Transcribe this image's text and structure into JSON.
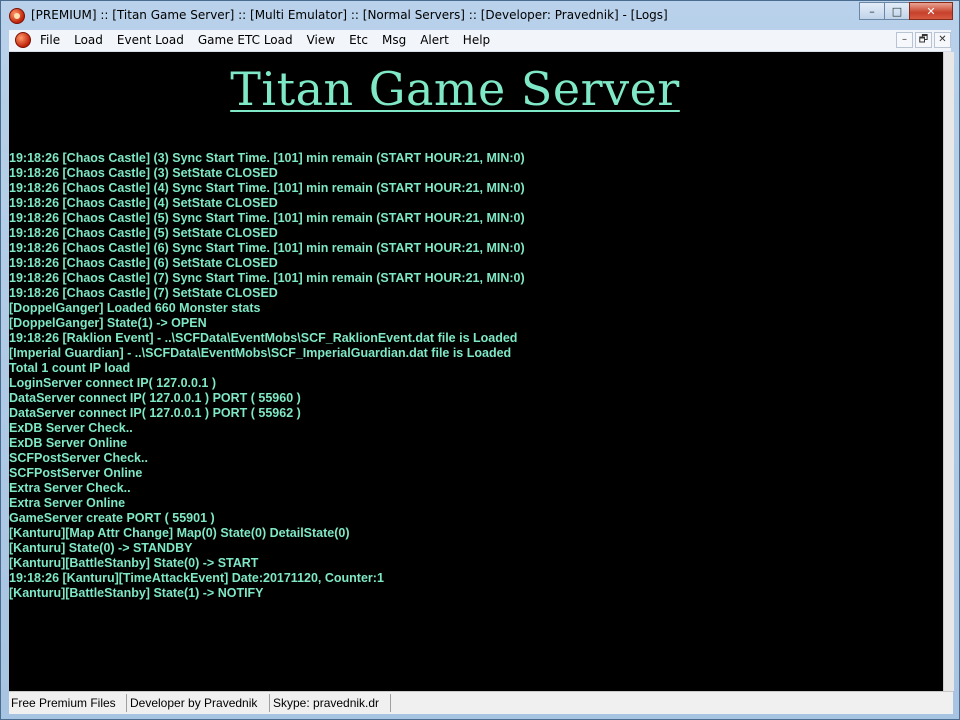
{
  "window": {
    "title": "[PREMIUM] :: [Titan Game Server] :: [Multi Emulator] :: [Normal Servers] :: [Developer: Pravednik] - [Logs]",
    "caption_buttons": {
      "minimize": "–",
      "maximize": "□",
      "close": "✕"
    }
  },
  "menu": {
    "items": [
      "File",
      "Load",
      "Event Load",
      "Game ETC Load",
      "View",
      "Etc",
      "Msg",
      "Alert",
      "Help"
    ],
    "mdi_buttons": {
      "minimize": "–",
      "restore": "🗗",
      "close": "✕"
    }
  },
  "content": {
    "heading": "Titan Game Server",
    "log_lines": [
      "19:18:26 [Chaos Castle] (3) Sync Start Time. [101] min remain (START HOUR:21, MIN:0)",
      "19:18:26 [Chaos Castle] (3) SetState CLOSED",
      "19:18:26 [Chaos Castle] (4) Sync Start Time. [101] min remain (START HOUR:21, MIN:0)",
      "19:18:26 [Chaos Castle] (4) SetState CLOSED",
      "19:18:26 [Chaos Castle] (5) Sync Start Time. [101] min remain (START HOUR:21, MIN:0)",
      "19:18:26 [Chaos Castle] (5) SetState CLOSED",
      "19:18:26 [Chaos Castle] (6) Sync Start Time. [101] min remain (START HOUR:21, MIN:0)",
      "19:18:26 [Chaos Castle] (6) SetState CLOSED",
      "19:18:26 [Chaos Castle] (7) Sync Start Time. [101] min remain (START HOUR:21, MIN:0)",
      "19:18:26 [Chaos Castle] (7) SetState CLOSED",
      "[DoppelGanger] Loaded 660 Monster stats",
      "[DoppelGanger] State(1) -> OPEN",
      "19:18:26 [Raklion Event] - ..\\SCFData\\EventMobs\\SCF_RaklionEvent.dat file is Loaded",
      "[Imperial Guardian] - ..\\SCFData\\EventMobs\\SCF_ImperialGuardian.dat file is Loaded",
      "Total 1 count IP load",
      "LoginServer connect IP( 127.0.0.1 )",
      "DataServer connect IP( 127.0.0.1 ) PORT ( 55960 )",
      "DataServer connect IP( 127.0.0.1 ) PORT ( 55962 )",
      "ExDB Server Check..",
      "ExDB Server Online",
      "SCFPostServer Check..",
      "SCFPostServer Online",
      "Extra Server Check..",
      "Extra Server Online",
      "GameServer create PORT ( 55901 )",
      "[Kanturu][Map Attr Change] Map(0) State(0) DetailState(0)",
      "[Kanturu] State(0) -> STANDBY",
      "[Kanturu][BattleStanby] State(0) -> START",
      "19:18:26 [Kanturu][TimeAttackEvent] Date:20171120, Counter:1",
      "[Kanturu][BattleStanby] State(1) -> NOTIFY"
    ]
  },
  "status": {
    "panels": [
      "Free Premium Files",
      "Developer by Pravednik",
      "Skype: pravednik.dr"
    ]
  },
  "colors": {
    "log_text": "#7fe8c6",
    "log_background": "#000000",
    "title_bar": "#b9d1ea"
  }
}
